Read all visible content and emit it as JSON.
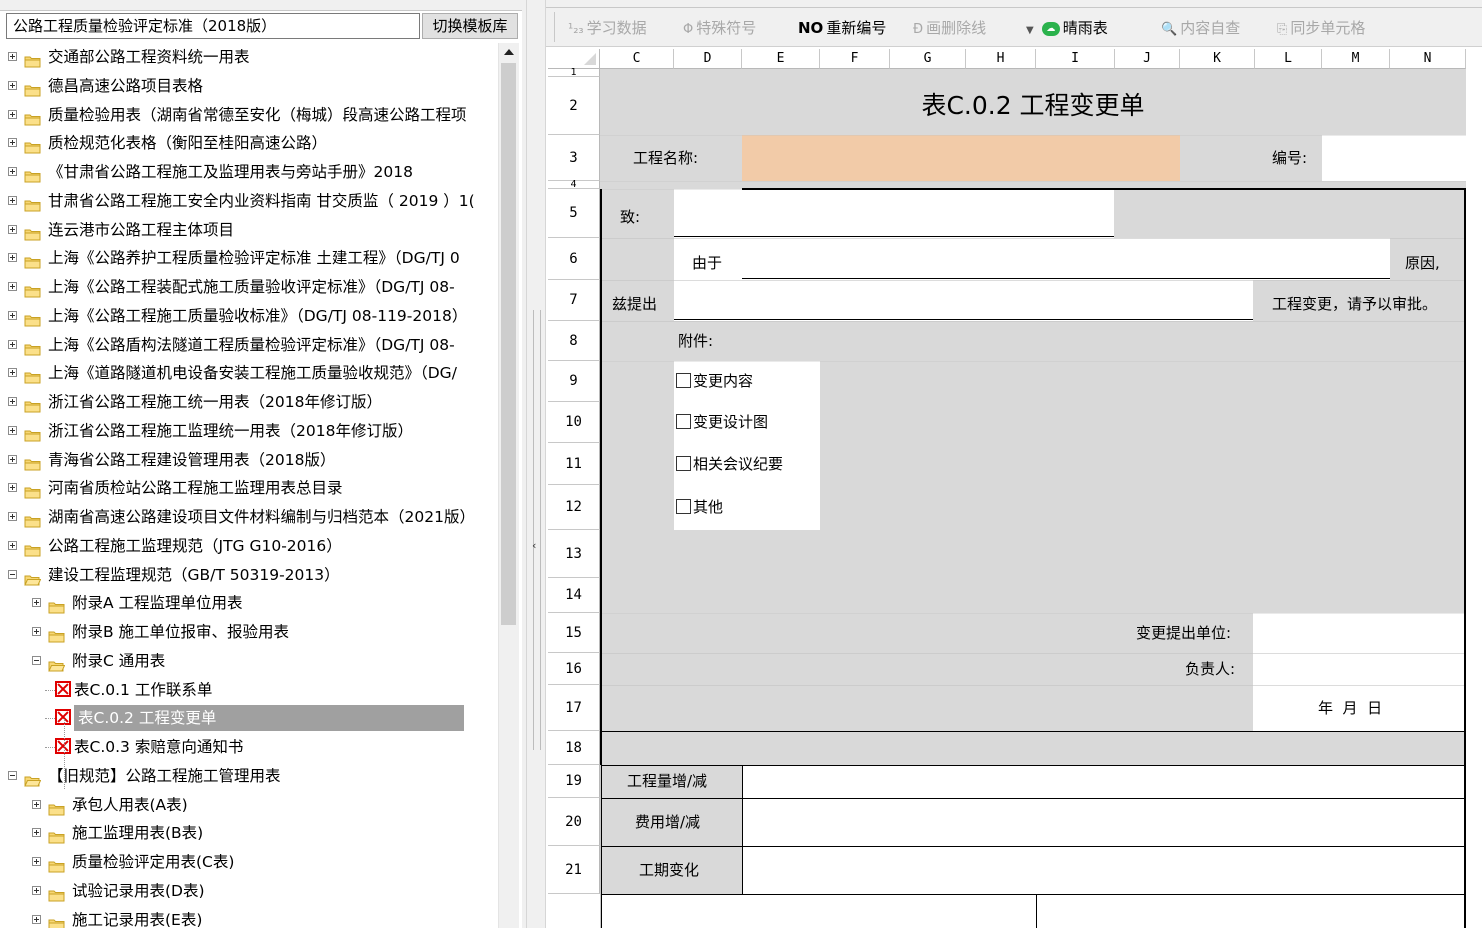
{
  "left_panel": {
    "template_name": "公路工程质量检验评定标准（2018版）",
    "switch_button": "切换模板库",
    "tree": [
      {
        "label": "交通部公路工程资料统一用表",
        "level": 0,
        "type": "folder",
        "expanded": false
      },
      {
        "label": "德昌高速公路项目表格",
        "level": 0,
        "type": "folder",
        "expanded": false
      },
      {
        "label": "质量检验用表（湖南省常德至安化（梅城）段高速公路工程项",
        "level": 0,
        "type": "folder",
        "expanded": false
      },
      {
        "label": "质检规范化表格（衡阳至桂阳高速公路）",
        "level": 0,
        "type": "folder",
        "expanded": false
      },
      {
        "label": "《甘肃省公路工程施工及监理用表与旁站手册》2018",
        "level": 0,
        "type": "folder",
        "expanded": false
      },
      {
        "label": "甘肃省公路工程施工安全内业资料指南 甘交质监（ 2019 ）1(",
        "level": 0,
        "type": "folder",
        "expanded": false
      },
      {
        "label": "连云港市公路工程主体项目",
        "level": 0,
        "type": "folder",
        "expanded": false
      },
      {
        "label": "上海《公路养护工程质量检验评定标准 土建工程》（DG/TJ 0",
        "level": 0,
        "type": "folder",
        "expanded": false
      },
      {
        "label": "上海《公路工程装配式施工质量验收评定标准》（DG/TJ 08-",
        "level": 0,
        "type": "folder",
        "expanded": false
      },
      {
        "label": "上海《公路工程施工质量验收标准》（DG/TJ 08-119-2018）",
        "level": 0,
        "type": "folder",
        "expanded": false
      },
      {
        "label": "上海《公路盾构法隧道工程质量检验评定标准》（DG/TJ 08-",
        "level": 0,
        "type": "folder",
        "expanded": false
      },
      {
        "label": "上海《道路隧道机电设备安装工程施工质量验收规范》（DG/",
        "level": 0,
        "type": "folder",
        "expanded": false
      },
      {
        "label": "浙江省公路工程施工统一用表（2018年修订版）",
        "level": 0,
        "type": "folder",
        "expanded": false
      },
      {
        "label": "浙江省公路工程施工监理统一用表（2018年修订版）",
        "level": 0,
        "type": "folder",
        "expanded": false
      },
      {
        "label": "青海省公路工程建设管理用表（2018版）",
        "level": 0,
        "type": "folder",
        "expanded": false
      },
      {
        "label": "河南省质检站公路工程施工监理用表总目录",
        "level": 0,
        "type": "folder",
        "expanded": false
      },
      {
        "label": "湖南省高速公路建设项目文件材料编制与归档范本（2021版）",
        "level": 0,
        "type": "folder",
        "expanded": false
      },
      {
        "label": "公路工程施工监理规范（JTG G10-2016）",
        "level": 0,
        "type": "folder",
        "expanded": false
      },
      {
        "label": "建设工程监理规范（GB/T 50319-2013）",
        "level": 0,
        "type": "folder",
        "expanded": true
      },
      {
        "label": "附录A 工程监理单位用表",
        "level": 1,
        "type": "folder",
        "expanded": false
      },
      {
        "label": "附录B 施工单位报审、报验用表",
        "level": 1,
        "type": "folder",
        "expanded": false
      },
      {
        "label": "附录C 通用表",
        "level": 1,
        "type": "folder",
        "expanded": true
      },
      {
        "label": "表C.0.1 工作联系单",
        "level": 2,
        "type": "doc"
      },
      {
        "label": "表C.0.2 工程变更单",
        "level": 2,
        "type": "doc",
        "selected": true
      },
      {
        "label": "表C.0.3 索赔意向通知书",
        "level": 2,
        "type": "doc"
      },
      {
        "label": "【旧规范】公路工程施工管理用表",
        "level": 0,
        "type": "folder",
        "expanded": true
      },
      {
        "label": "承包人用表(A表)",
        "level": 1,
        "type": "folder",
        "expanded": false
      },
      {
        "label": "施工监理用表(B表)",
        "level": 1,
        "type": "folder",
        "expanded": false
      },
      {
        "label": "质量检验评定用表(C表)",
        "level": 1,
        "type": "folder",
        "expanded": false
      },
      {
        "label": "试验记录用表(D表)",
        "level": 1,
        "type": "folder",
        "expanded": false
      },
      {
        "label": "施工记录用表(E表)",
        "level": 1,
        "type": "folder",
        "expanded": false
      }
    ]
  },
  "toolbar": [
    {
      "label": "学习数据",
      "icon": "123-icon",
      "icon_text": "¹₂₃",
      "enabled": false
    },
    {
      "label": "特殊符号",
      "icon": "special-symbol-icon",
      "icon_text": "Φ",
      "enabled": false
    },
    {
      "label": "重新编号",
      "icon": "renumber-icon",
      "icon_text": "NO",
      "enabled": true
    },
    {
      "label": "画删除线",
      "icon": "strikethrough-icon",
      "icon_text": "Đ",
      "enabled": false
    },
    {
      "label": "晴雨表",
      "icon": "weather-icon",
      "icon_text": "☁",
      "enabled": true,
      "dropdown": true
    },
    {
      "label": "内容自查",
      "icon": "magnifier-icon",
      "icon_text": "🔍",
      "enabled": false
    },
    {
      "label": "同步单元格",
      "icon": "sync-cells-icon",
      "icon_text": "⎘",
      "enabled": false
    }
  ],
  "grid": {
    "columns": [
      "C",
      "D",
      "E",
      "F",
      "G",
      "H",
      "I",
      "J",
      "K",
      "L",
      "M",
      "N"
    ],
    "rows": [
      "1",
      "2",
      "3",
      "4",
      "5",
      "6",
      "7",
      "8",
      "9",
      "10",
      "11",
      "12",
      "13",
      "14",
      "15",
      "16",
      "17",
      "18",
      "19",
      "20",
      "21"
    ]
  },
  "form": {
    "title": "表C.0.2 工程变更单",
    "project_name_label": "工程名称:",
    "number_label": "编号:",
    "to_label": "致:",
    "due_to_label": "由于",
    "reason_label": "原因,",
    "hereby_label": "兹提出",
    "change_request_text": "工程变更，请予以审批。",
    "attachments_label": "附件:",
    "attachments": [
      "变更内容",
      "变更设计图",
      "相关会议纪要",
      "其他"
    ],
    "unit_label": "变更提出单位:",
    "person_label": "负责人:",
    "date_text": "年  月  日",
    "quantity_label": "工程量增/减",
    "cost_label": "费用增/减",
    "period_label": "工期变化",
    "project_name_fill_color": "#f2cba8"
  }
}
